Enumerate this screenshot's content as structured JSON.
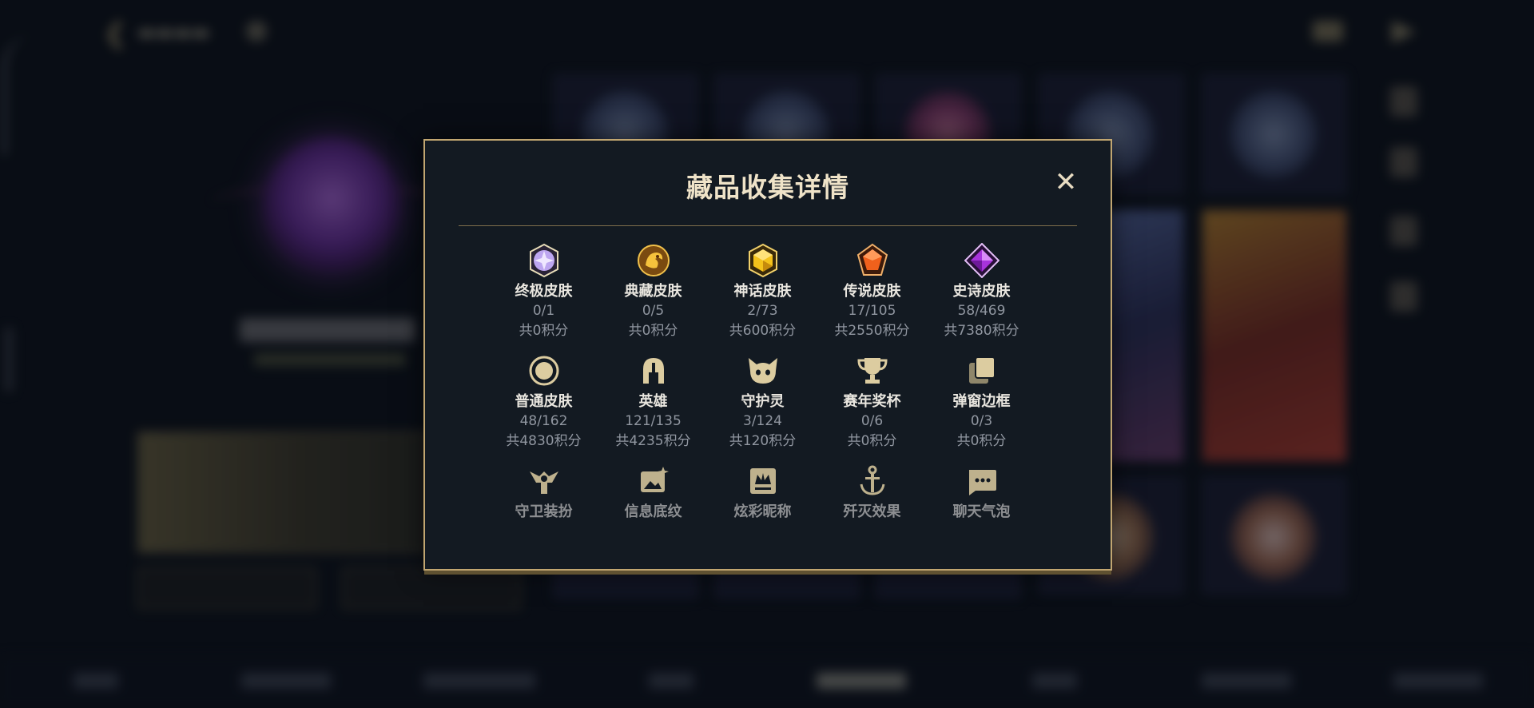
{
  "dialog": {
    "title": "藏品收集详情",
    "close_glyph": "✕",
    "categories": [
      {
        "label": "终极皮肤",
        "count": "0/1",
        "points": "共0积分",
        "icon": "ultimate-skin-gem-icon",
        "color": "#c9b7f5"
      },
      {
        "label": "典藏皮肤",
        "count": "0/5",
        "points": "共0积分",
        "icon": "prestige-skin-dragon-icon",
        "color": "#e2a632"
      },
      {
        "label": "神话皮肤",
        "count": "2/73",
        "points": "共600积分",
        "icon": "mythic-skin-gem-icon",
        "color": "#f2c21f"
      },
      {
        "label": "传说皮肤",
        "count": "17/105",
        "points": "共2550积分",
        "icon": "legendary-skin-gem-icon",
        "color": "#f0631e"
      },
      {
        "label": "史诗皮肤",
        "count": "58/469",
        "points": "共7380积分",
        "icon": "epic-skin-gem-icon",
        "color": "#b23fe0"
      },
      {
        "label": "普通皮肤",
        "count": "48/162",
        "points": "共4830积分",
        "icon": "normal-skin-circle-icon",
        "color": "#d9c79a"
      },
      {
        "label": "英雄",
        "count": "121/135",
        "points": "共4235积分",
        "icon": "hero-helmet-icon",
        "color": "#d9c79a"
      },
      {
        "label": "守护灵",
        "count": "3/124",
        "points": "共120积分",
        "icon": "guardian-spirit-icon",
        "color": "#d9c79a"
      },
      {
        "label": "赛年奖杯",
        "count": "0/6",
        "points": "共0积分",
        "icon": "trophy-icon",
        "color": "#d9c79a"
      },
      {
        "label": "弹窗边框",
        "count": "0/3",
        "points": "共0积分",
        "icon": "popup-frame-icon",
        "color": "#d9c79a"
      },
      {
        "label": "守卫装扮",
        "icon": "ward-skin-icon",
        "color": "#d9c79a"
      },
      {
        "label": "信息底纹",
        "icon": "info-background-icon",
        "color": "#d9c79a"
      },
      {
        "label": "炫彩昵称",
        "icon": "colorful-nickname-icon",
        "color": "#d9c79a"
      },
      {
        "label": "歼灭效果",
        "icon": "annihilation-effect-icon",
        "color": "#d9c79a"
      },
      {
        "label": "聊天气泡",
        "icon": "chat-bubble-icon",
        "color": "#d9c79a"
      }
    ]
  }
}
